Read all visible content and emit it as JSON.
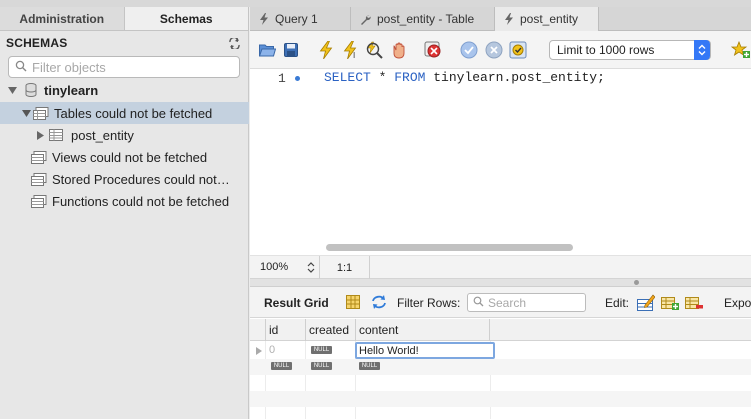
{
  "left_panel": {
    "tabs": [
      "Administration",
      "Schemas"
    ],
    "active_tab": "Schemas",
    "section_title": "SCHEMAS",
    "filter_placeholder": "Filter objects",
    "tree": {
      "schema_name": "tinylearn",
      "tables_node": "Tables could not be fetched",
      "table_item": "post_entity",
      "views_node": "Views could not be fetched",
      "procedures_node": "Stored Procedures could not…",
      "functions_node": "Functions could not be fetched"
    }
  },
  "editor_tabs": [
    {
      "label": "Query 1",
      "icon": "lightning-icon"
    },
    {
      "label": "post_entity - Table",
      "icon": "wrench-icon"
    },
    {
      "label": "post_entity",
      "icon": "lightning-icon"
    }
  ],
  "toolbar": {
    "icons": [
      "open-folder-icon",
      "save-icon",
      "execute-icon",
      "execute-current-icon",
      "explain-icon",
      "stop-icon",
      "toggle-error-icon",
      "commit-icon",
      "rollback-icon",
      "autocommit-icon",
      "add-snippet-icon"
    ],
    "limit_select": "Limit to 1000 rows"
  },
  "editor": {
    "line_number": "1",
    "sql": {
      "kw1": "SELECT",
      "star": " * ",
      "kw2": "FROM",
      "rest": " tinylearn.post_entity;"
    }
  },
  "status_strip": {
    "zoom": "100%",
    "cursor": "1:1"
  },
  "result_bar": {
    "label": "Result Grid",
    "filter_label": "Filter Rows:",
    "search_placeholder": "Search",
    "edit_label": "Edit:",
    "export_label": "Expor"
  },
  "result_grid": {
    "columns": [
      "id",
      "created",
      "content"
    ],
    "rows": [
      {
        "id": "0",
        "created": "NULL",
        "content": "Hello World!"
      },
      {
        "id": "NULL",
        "created": "NULL",
        "content": "NULL"
      }
    ]
  },
  "colors": {
    "selection": "#c4d1df",
    "keyword": "#2b62c3",
    "accent": "#3478f6"
  }
}
